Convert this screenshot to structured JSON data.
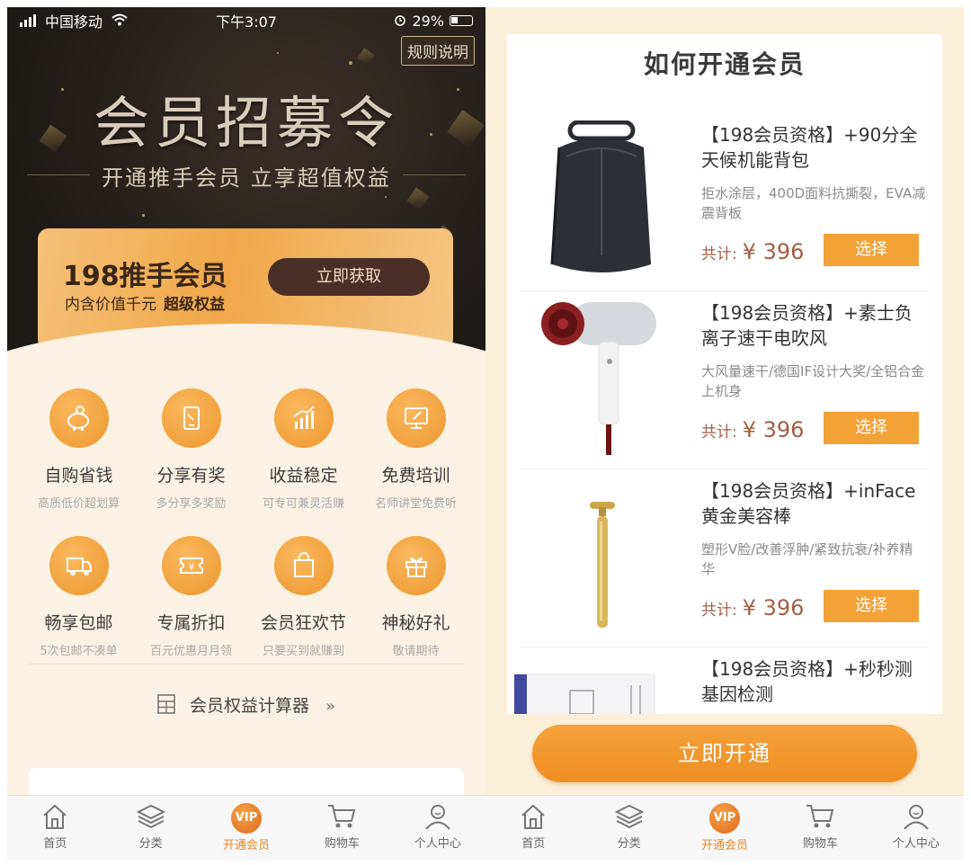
{
  "status_left": {
    "carrier": "中国移动",
    "time": "下午3:07",
    "battery": "29%"
  },
  "left": {
    "rules_label": "规则说明",
    "hero_title": "会员招募令",
    "hero_subtitle": "开通推手会员  立享超值权益",
    "vip_card": {
      "title": "198推手会员",
      "desc_a": "内含价值千元",
      "desc_b": "超级权益",
      "button": "立即获取"
    },
    "benefits": [
      {
        "title": "自购省钱",
        "sub": "高质低价超划算",
        "icon": "piggy-bank-icon"
      },
      {
        "title": "分享有奖",
        "sub": "多分享多奖励",
        "icon": "tablet-icon"
      },
      {
        "title": "收益稳定",
        "sub": "可专可兼灵活赚",
        "icon": "growth-chart-icon"
      },
      {
        "title": "免费培训",
        "sub": "名师讲堂免费听",
        "icon": "monitor-icon"
      },
      {
        "title": "畅享包邮",
        "sub": "5次包邮不凑单",
        "icon": "truck-icon"
      },
      {
        "title": "专属折扣",
        "sub": "百元优惠月月领",
        "icon": "coupon-icon"
      },
      {
        "title": "会员狂欢节",
        "sub": "只要买到就赚到",
        "icon": "shopping-bag-icon"
      },
      {
        "title": "神秘好礼",
        "sub": "敬请期待",
        "icon": "gift-icon"
      }
    ],
    "calculator": "会员权益计算器",
    "calculator_chevron": "»"
  },
  "right": {
    "title": "如何开通会员",
    "price_label": "共计:",
    "products": [
      {
        "name": "【198会员资格】+90分全天候机能背包",
        "desc": "拒水涂层，400D面料抗撕裂，EVA减震背板",
        "price": "¥ 396",
        "button": "选择",
        "image": "backpack-image"
      },
      {
        "name": "【198会员资格】+素士负离子速干电吹风",
        "desc": "大风量速干/德国IF设计大奖/全铝合金上机身",
        "price": "¥ 396",
        "button": "选择",
        "image": "hair-dryer-image"
      },
      {
        "name": "【198会员资格】+inFace黄金美容棒",
        "desc": "塑形V脸/改善浮肿/紧致抗衰/补养精华",
        "price": "¥ 396",
        "button": "选择",
        "image": "beauty-bar-image"
      },
      {
        "name": "【198会员资格】+秒秒测基因检测",
        "desc": "",
        "price": "",
        "button": "",
        "image": "gene-test-box-image"
      }
    ],
    "open_button": "立即开通"
  },
  "tabbar": {
    "items": [
      {
        "label": "首页",
        "icon": "home-icon"
      },
      {
        "label": "分类",
        "icon": "layers-icon"
      },
      {
        "label": "开通会员",
        "icon": "vip-icon",
        "badge": "VIP"
      },
      {
        "label": "购物车",
        "icon": "cart-icon"
      },
      {
        "label": "个人中心",
        "icon": "user-icon"
      }
    ],
    "active_index": 2
  },
  "colors": {
    "accent": "#ee962e",
    "active_tab": "#e6892a",
    "price": "#a25f45",
    "dark_button": "#4a2f26"
  }
}
